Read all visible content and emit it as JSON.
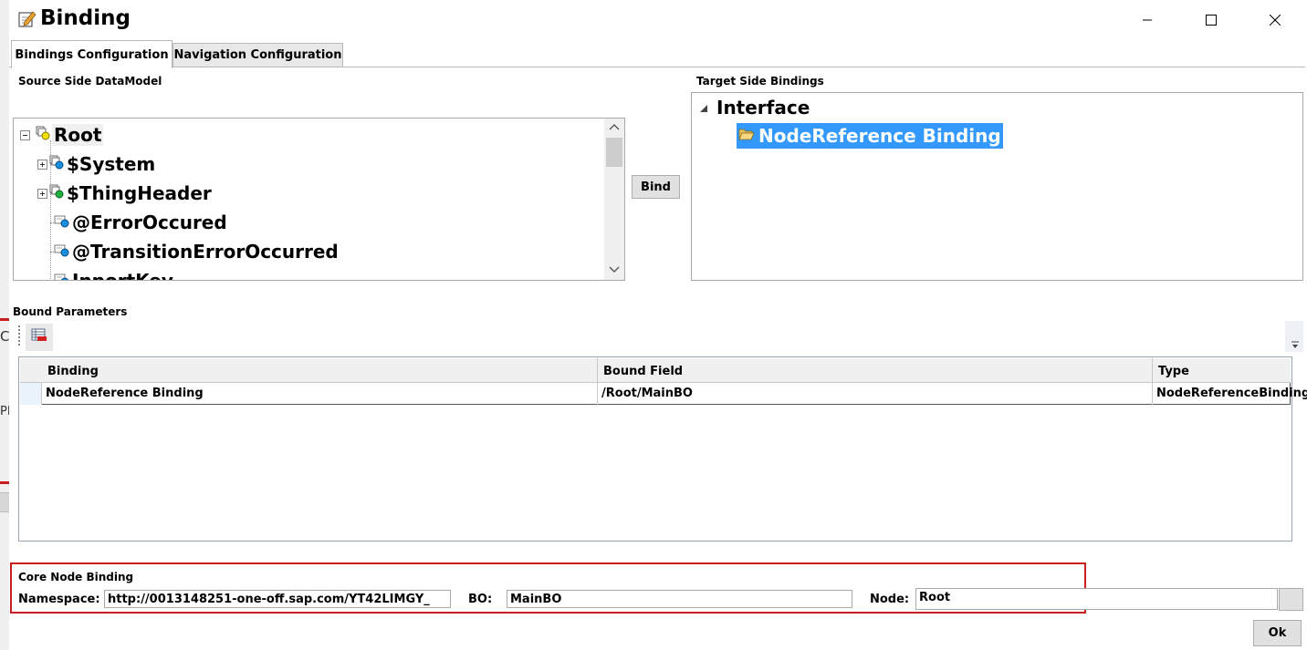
{
  "window": {
    "title": "Binding",
    "icons": {
      "app": "edit-pencil-icon",
      "minimize": "minimize-icon",
      "maximize": "maximize-icon",
      "close": "close-icon"
    }
  },
  "background": {
    "text1": "Co",
    "text2": "PL"
  },
  "tabs": [
    {
      "label": "Bindings Configuration",
      "active": true
    },
    {
      "label": "Navigation Configuration",
      "active": false
    }
  ],
  "source": {
    "label": "Source Side DataModel",
    "nodes": [
      {
        "label": "Root",
        "expanded": true,
        "icon": "node-yellow-icon"
      },
      {
        "label": "$System",
        "expanded": false,
        "icon": "node-blue-icon"
      },
      {
        "label": "$ThingHeader",
        "expanded": false,
        "icon": "node-green-icon"
      },
      {
        "label": "@ErrorOccured",
        "icon": "element-icon"
      },
      {
        "label": "@TransitionErrorOccurred",
        "icon": "element-icon"
      },
      {
        "label": "InportKey",
        "icon": "element-icon"
      }
    ]
  },
  "bind_button": "Bind",
  "target": {
    "label": "Target Side Bindings",
    "root": "Interface",
    "child": "NodeReference Binding",
    "child_icon": "folder-open-icon"
  },
  "bound": {
    "label": "Bound Parameters",
    "toolbar_icon": "grid-remove-icon",
    "columns": [
      "Binding",
      "Bound Field",
      "Type"
    ],
    "rows": [
      {
        "binding": "NodeReference Binding",
        "field": "/Root/MainBO",
        "type": "NodeReferenceBinding"
      }
    ]
  },
  "core": {
    "label": "Core Node Binding",
    "namespace_label": "Namespace:",
    "namespace_value": "http://0013148251-one-off.sap.com/YT42LIMGY_",
    "bo_label": "BO:",
    "bo_value": "MainBO",
    "node_label": "Node:",
    "node_value": "Root"
  },
  "ok_button": "Ok",
  "colors": {
    "selection": "#3399ff",
    "highlight_box": "#c81e1e"
  }
}
